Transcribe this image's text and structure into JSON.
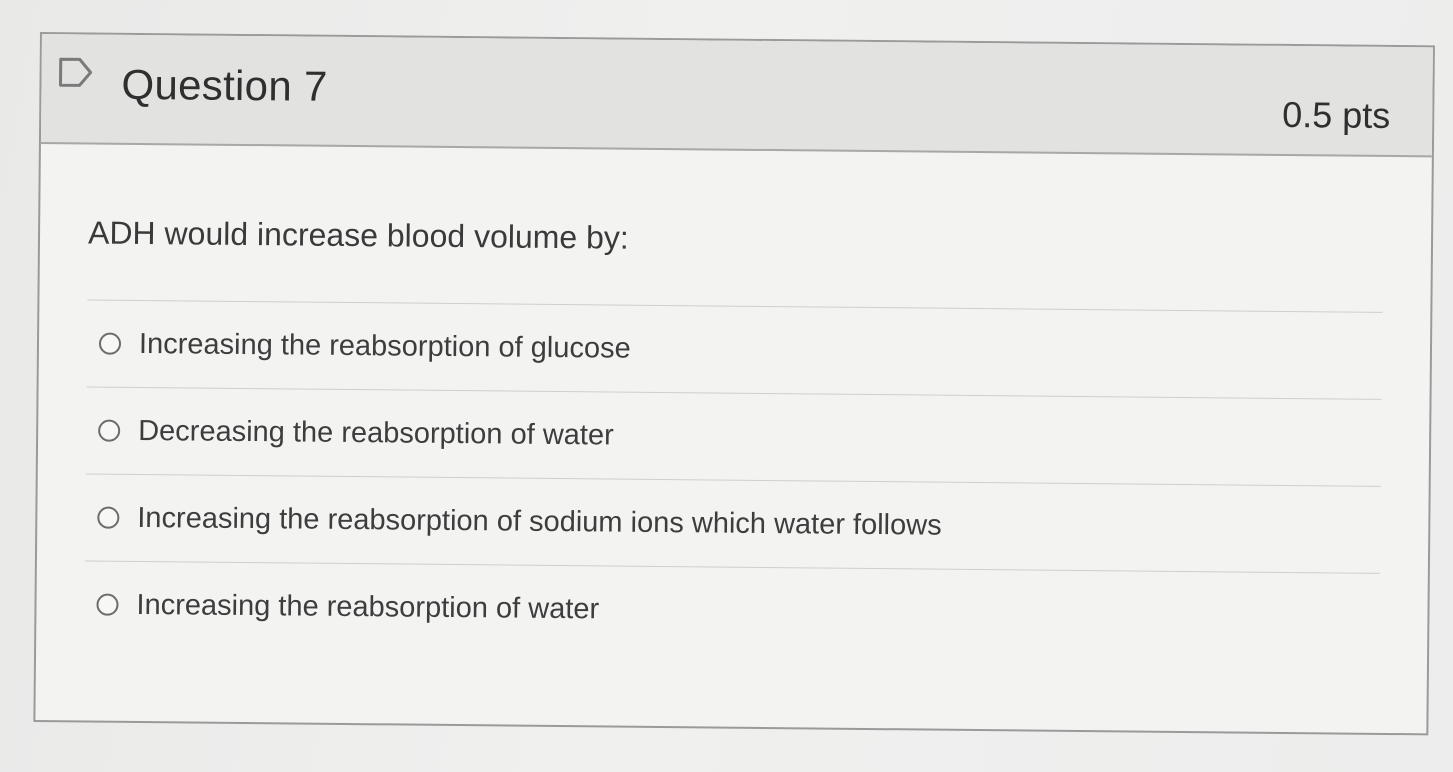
{
  "question": {
    "title": "Question 7",
    "points": "0.5 pts",
    "flag_icon": "flag-icon",
    "text": "ADH would increase blood volume by:"
  },
  "answers": [
    {
      "label": "Increasing the reabsorption of glucose",
      "selected": false
    },
    {
      "label": "Decreasing the reabsorption of water",
      "selected": false
    },
    {
      "label": "Increasing the reabsorption of sodium ions which water follows",
      "selected": false
    },
    {
      "label": "Increasing the reabsorption of water",
      "selected": false
    }
  ],
  "colors": {
    "header_bg": "#e2e2e1",
    "card_bg": "#f3f3f2",
    "border": "#9a9a9a",
    "text": "#2f2f30"
  }
}
